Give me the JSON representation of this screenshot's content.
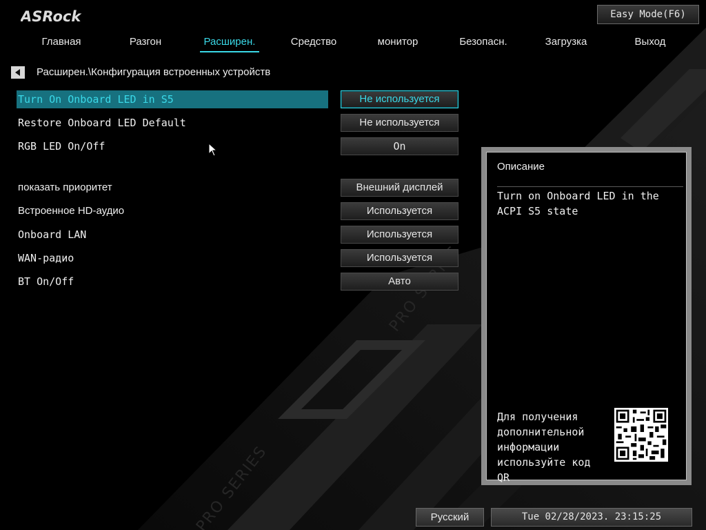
{
  "header": {
    "logo": "ASRock",
    "easy_mode": "Easy Mode(F6)"
  },
  "tabs": [
    {
      "label": "Главная"
    },
    {
      "label": "Разгон"
    },
    {
      "label": "Расширен."
    },
    {
      "label": "Средство"
    },
    {
      "label": "монитор"
    },
    {
      "label": "Безопасн."
    },
    {
      "label": "Загрузка"
    },
    {
      "label": "Выход"
    }
  ],
  "active_tab": "Расширен.",
  "breadcrumb": "Расширен.\\Конфигурация встроенных устройств",
  "settings": [
    {
      "label": "Turn On Onboard LED in S5",
      "value": "Не используется",
      "selected": true
    },
    {
      "label": "Restore Onboard LED Default",
      "value": "Не используется"
    },
    {
      "label": "RGB LED On/Off",
      "value": "On"
    },
    {
      "label": "показать приоритет",
      "value": "Внешний дисплей"
    },
    {
      "label": "Встроенное HD-аудио",
      "value": "Используется"
    },
    {
      "label": "Onboard LAN",
      "value": "Используется"
    },
    {
      "label": "WAN-радио",
      "value": "Используется"
    },
    {
      "label": "BT On/Off",
      "value": "Авто"
    }
  ],
  "description": {
    "title": "Описание",
    "text": "Turn on Onboard LED in the ACPI S5 state",
    "qr_text": "Для получения дополнительной информации используйте код QR"
  },
  "background_watermark": "PRO SERIES",
  "footer": {
    "language": "Русский",
    "datetime": "Tue 02/28/2023. 23:15:25"
  },
  "colors": {
    "accent": "#3ad9e8",
    "selected_row": "#17717f",
    "background": "#000000"
  }
}
